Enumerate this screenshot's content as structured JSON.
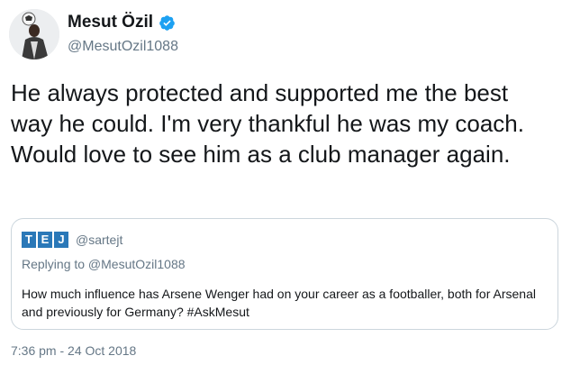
{
  "author": {
    "display_name": "Mesut Özil",
    "handle": "@MesutOzil1088",
    "verified_icon": "verified-badge-icon",
    "avatar_icon": "profile-photo"
  },
  "tweet": {
    "text": "He always protected and supported me the best way he could. I'm very thankful he was my coach. Would love to see him as a club manager again.",
    "timestamp": "7:36 pm - 24 Oct 2018"
  },
  "quoted": {
    "logo_letters": [
      "T",
      "E",
      "J"
    ],
    "handle": "@sartejt",
    "reply_line": "Replying to @MesutOzil1088",
    "text": "How much influence has Arsene Wenger had on your career as a footballer, both for Arsenal and previously for Germany? #AskMesut"
  },
  "colors": {
    "text_primary": "#14171a",
    "text_secondary": "#657786",
    "verified_blue": "#1da1f2",
    "logo_blue": "#2a78b8",
    "card_border": "#ccd6dd"
  }
}
